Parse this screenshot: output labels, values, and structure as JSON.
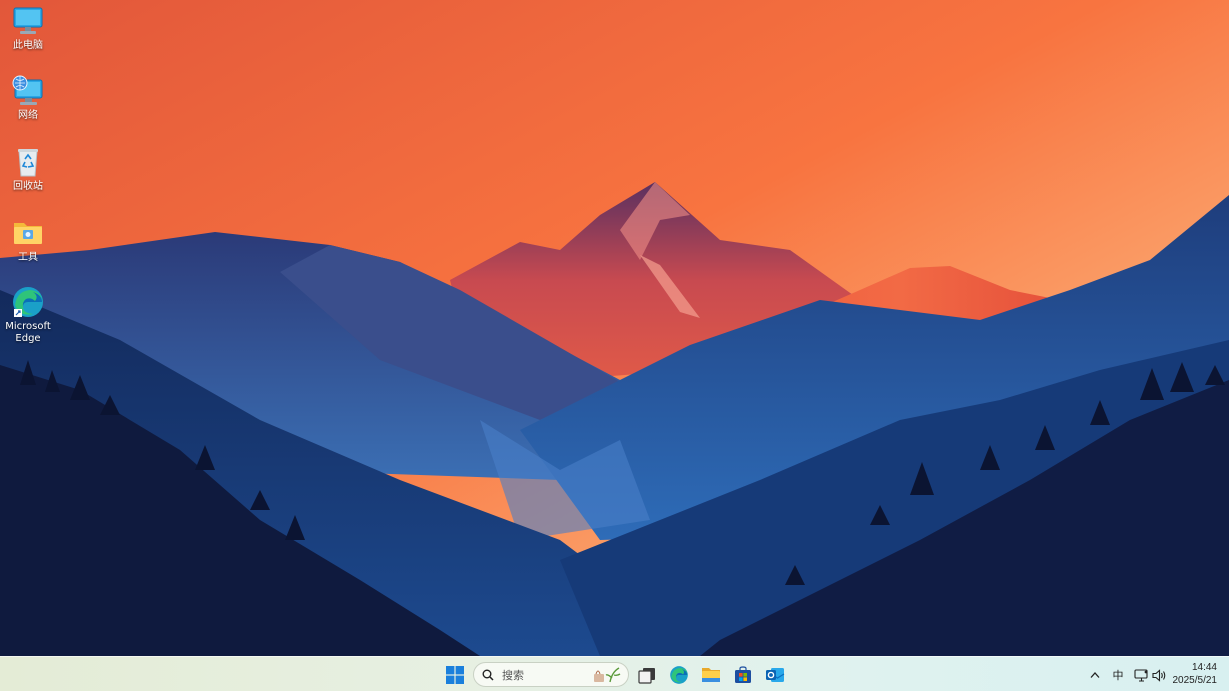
{
  "desktop": {
    "icons": [
      {
        "label": "此电脑",
        "icon": "monitor-icon"
      },
      {
        "label": "网络",
        "icon": "network-globe-icon"
      },
      {
        "label": "回收站",
        "icon": "recycle-bin-icon"
      },
      {
        "label": "工具",
        "icon": "folder-icon"
      },
      {
        "label": "Microsoft Edge",
        "icon": "edge-icon"
      }
    ],
    "wallpaper": {
      "theme": "sunset-mountains",
      "colors": {
        "sky_top": "#e8643a",
        "sky_horizon": "#fde0b0",
        "mountain_deep": "#0f1a3e",
        "mountain_mid": "#2a5a9a"
      }
    }
  },
  "taskbar": {
    "start_icon": "windows-start-icon",
    "search": {
      "placeholder": "搜索"
    },
    "pinned": [
      {
        "name": "task-view",
        "icon": "task-view-icon"
      },
      {
        "name": "edge",
        "icon": "edge-icon"
      },
      {
        "name": "file-explorer",
        "icon": "file-explorer-icon"
      },
      {
        "name": "microsoft-store",
        "icon": "store-icon"
      },
      {
        "name": "outlook",
        "icon": "outlook-icon"
      }
    ],
    "tray": {
      "overflow_icon": "chevron-up-icon",
      "ime": "中",
      "network_icon": "network-icon",
      "volume_icon": "volume-icon"
    },
    "clock": {
      "time": "14:44",
      "date": "2025/5/21"
    }
  }
}
